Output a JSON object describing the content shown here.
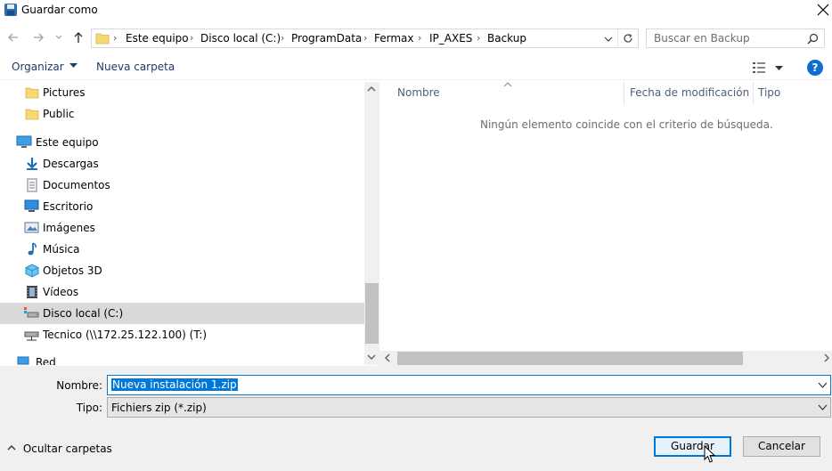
{
  "window": {
    "title": "Guardar como"
  },
  "address": {
    "crumbs": [
      "Este equipo",
      "Disco local (C:)",
      "ProgramData",
      "Fermax",
      "IP_AXES",
      "Backup"
    ]
  },
  "search": {
    "placeholder": "Buscar en Backup"
  },
  "toolbar": {
    "organize_label": "Organizar",
    "new_folder_label": "Nueva carpeta"
  },
  "nav_tree": {
    "items": [
      {
        "label": "Pictures",
        "icon": "folder-icon"
      },
      {
        "label": "Public",
        "icon": "folder-icon"
      },
      {
        "label": "Este equipo",
        "icon": "computer-icon"
      },
      {
        "label": "Descargas",
        "icon": "download-icon"
      },
      {
        "label": "Documentos",
        "icon": "documents-icon"
      },
      {
        "label": "Escritorio",
        "icon": "desktop-icon"
      },
      {
        "label": "Imágenes",
        "icon": "pictures-icon"
      },
      {
        "label": "Música",
        "icon": "music-icon"
      },
      {
        "label": "Objetos 3D",
        "icon": "objects3d-icon"
      },
      {
        "label": "Vídeos",
        "icon": "videos-icon"
      },
      {
        "label": "Disco local (C:)",
        "icon": "drive-icon",
        "selected": true
      },
      {
        "label": "Tecnico (\\\\172.25.122.100) (T:)",
        "icon": "network-drive-icon"
      },
      {
        "label": "Red",
        "icon": "network-icon"
      }
    ]
  },
  "file_list": {
    "columns": [
      "Nombre",
      "Fecha de modificación",
      "Tipo"
    ],
    "empty_message": "Ningún elemento coincide con el criterio de búsqueda."
  },
  "form": {
    "name_label": "Nombre:",
    "name_value": "Nueva instalación 1.zip",
    "type_label": "Tipo:",
    "type_value": "Fichiers zip (*.zip)"
  },
  "footer": {
    "hide_folders_label": "Ocultar carpetas",
    "save_label": "Guardar",
    "cancel_label": "Cancelar"
  },
  "colors": {
    "accent": "#0078d7",
    "selection_bg": "#d9d9d9",
    "link_text": "#1e3b6b"
  }
}
